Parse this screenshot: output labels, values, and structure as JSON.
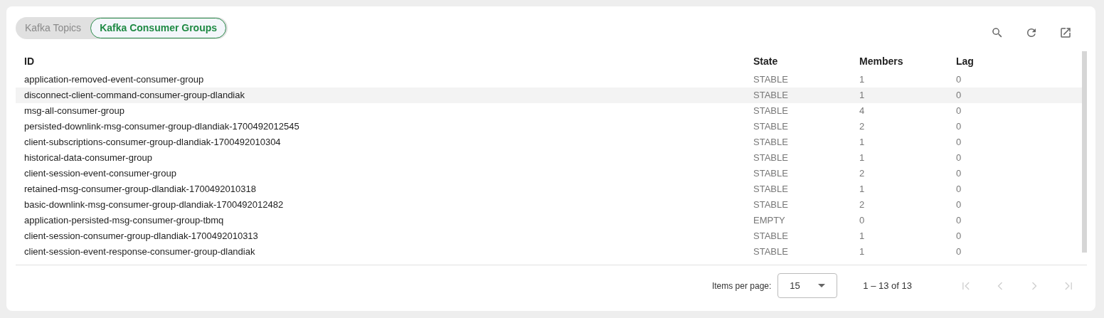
{
  "toggle": [
    {
      "label": "Kafka Topics",
      "selected": false
    },
    {
      "label": "Kafka Consumer Groups",
      "selected": true
    }
  ],
  "table": {
    "columns": [
      "ID",
      "State",
      "Members",
      "Lag"
    ],
    "rows": [
      {
        "cells": [
          "application-removed-event-consumer-group",
          "STABLE",
          "1",
          "0"
        ],
        "highlighted": false
      },
      {
        "cells": [
          "disconnect-client-command-consumer-group-dlandiak",
          "STABLE",
          "1",
          "0"
        ],
        "highlighted": true
      },
      {
        "cells": [
          "msg-all-consumer-group",
          "STABLE",
          "4",
          "0"
        ],
        "highlighted": false
      },
      {
        "cells": [
          "persisted-downlink-msg-consumer-group-dlandiak-1700492012545",
          "STABLE",
          "2",
          "0"
        ],
        "highlighted": false
      },
      {
        "cells": [
          "client-subscriptions-consumer-group-dlandiak-1700492010304",
          "STABLE",
          "1",
          "0"
        ],
        "highlighted": false
      },
      {
        "cells": [
          "historical-data-consumer-group",
          "STABLE",
          "1",
          "0"
        ],
        "highlighted": false
      },
      {
        "cells": [
          "client-session-event-consumer-group",
          "STABLE",
          "2",
          "0"
        ],
        "highlighted": false
      },
      {
        "cells": [
          "retained-msg-consumer-group-dlandiak-1700492010318",
          "STABLE",
          "1",
          "0"
        ],
        "highlighted": false
      },
      {
        "cells": [
          "basic-downlink-msg-consumer-group-dlandiak-1700492012482",
          "STABLE",
          "2",
          "0"
        ],
        "highlighted": false
      },
      {
        "cells": [
          "application-persisted-msg-consumer-group-tbmq",
          "EMPTY",
          "0",
          "0"
        ],
        "highlighted": false
      },
      {
        "cells": [
          "client-session-consumer-group-dlandiak-1700492010313",
          "STABLE",
          "1",
          "0"
        ],
        "highlighted": false
      },
      {
        "cells": [
          "client-session-event-response-consumer-group-dlandiak",
          "STABLE",
          "1",
          "0"
        ],
        "highlighted": false
      }
    ]
  },
  "paginator": {
    "items_label": "Items per page:",
    "page_size": "15",
    "range": "1 – 13 of 13",
    "buttons": [
      {
        "kind": "first",
        "disabled": true
      },
      {
        "kind": "prev",
        "disabled": true
      },
      {
        "kind": "next",
        "disabled": true
      },
      {
        "kind": "last",
        "disabled": true
      }
    ]
  }
}
